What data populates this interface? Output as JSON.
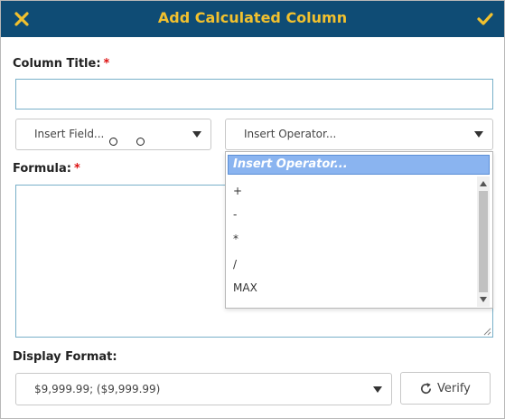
{
  "dialog": {
    "title": "Add Calculated Column",
    "close_icon": "close-x-icon",
    "confirm_icon": "checkmark-icon",
    "accent_color": "#f2c12e",
    "header_color": "#0f4c75"
  },
  "column_title": {
    "label": "Column Title:",
    "required_mark": "*",
    "value": ""
  },
  "insert_field": {
    "selected": "Insert Field..."
  },
  "insert_operator": {
    "selected": "Insert Operator...",
    "options": [
      "Insert Operator...",
      "+",
      "-",
      "*",
      "/",
      "MAX"
    ]
  },
  "formula": {
    "label": "Formula:",
    "required_mark": "*",
    "value": ""
  },
  "display_format": {
    "label": "Display Format:",
    "selected": "$9,999.99; ($9,999.99)"
  },
  "verify": {
    "label": "Verify",
    "icon": "refresh-icon"
  }
}
